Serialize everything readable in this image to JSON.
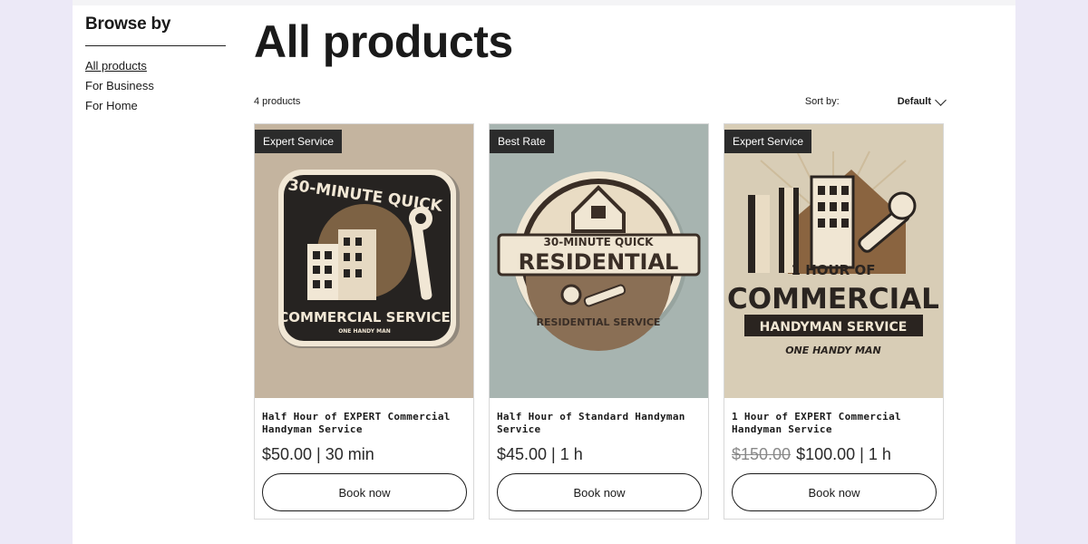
{
  "sidebar": {
    "title": "Browse by",
    "items": [
      {
        "label": "All products",
        "active": true
      },
      {
        "label": "For Business",
        "active": false
      },
      {
        "label": "For Home",
        "active": false
      }
    ]
  },
  "main": {
    "title": "All products",
    "count": "4 products",
    "sort_label": "Sort by:",
    "sort_value": "Default"
  },
  "products": [
    {
      "badge": "Expert Service",
      "name": "Half Hour of EXPERT Commercial Handyman Service",
      "price": "$50.00 | 30 min",
      "old_price": "",
      "book": "Book now",
      "image_text": {
        "top": "30-MINUTE QUICK",
        "main": "COMMERCIAL SERVICE",
        "sub": "ONE HANDY MAN"
      }
    },
    {
      "badge": "Best Rate",
      "name": "Half Hour of Standard Handyman Service",
      "price": "$45.00 | 1 h",
      "old_price": "",
      "book": "Book now",
      "image_text": {
        "top": "30-MINUTE QUICK",
        "main": "RESIDENTIAL",
        "sub": "RESIDENTIAL SERVICE"
      }
    },
    {
      "badge": "Expert Service",
      "name": "1 Hour of EXPERT Commercial Handyman Service",
      "price": "$100.00 | 1 h",
      "old_price": "$150.00",
      "book": "Book now",
      "image_text": {
        "top": "1 HOUR OF",
        "main": "COMMERCIAL",
        "mid": "HANDYMAN SERVICE",
        "sub": "ONE HANDY MAN"
      }
    }
  ],
  "colors": {
    "background": "#ece9f7",
    "badge_bg": "#2b2b2b",
    "card1_bg": "#c9b8a4",
    "card2_bg": "#a7b4b0",
    "card3_bg": "#d8cdb6"
  }
}
